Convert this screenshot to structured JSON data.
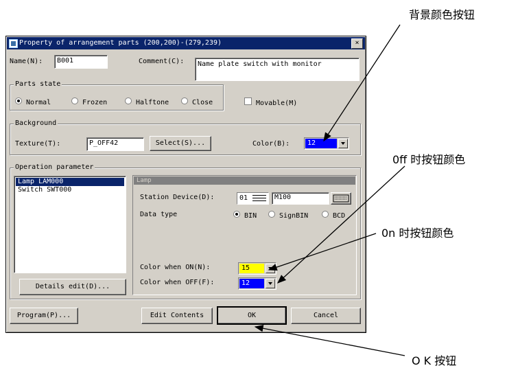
{
  "window": {
    "title": "Property of arrangement parts  (200,200)-(279,239)",
    "close_label": "×"
  },
  "name_field": {
    "label": "Name(N):",
    "value": "B001"
  },
  "comment_field": {
    "label": "Comment(C):",
    "value": "Name plate switch with monitor"
  },
  "parts_state": {
    "group_label": "Parts state",
    "options": [
      "Normal",
      "Frozen",
      "Halftone",
      "Close"
    ],
    "selected": "Normal",
    "movable_label": "Movable(M)"
  },
  "background": {
    "group_label": "Background",
    "texture_label": "Texture(T):",
    "texture_value": "P_OFF42",
    "select_button": "Select(S)...",
    "color_label": "Color(B):",
    "color_value": "12",
    "color_hex": "#0000ff"
  },
  "operation": {
    "group_label": "Operation parameter",
    "list_items": [
      "Lamp LAM000",
      "Switch SWT000"
    ],
    "details_button": "Details edit(D)...",
    "panel_title": "Lamp",
    "station_label": "Station Device(D):",
    "station_value": "01",
    "device_value": "M100",
    "data_type_label": "Data type",
    "data_types": [
      "BIN",
      "SignBIN",
      "BCD"
    ],
    "data_type_selected": "BIN",
    "color_on_label": "Color when ON(N):",
    "color_on_value": "15",
    "color_on_hex": "#ffff00",
    "color_off_label": "Color when OFF(F):",
    "color_off_value": "12",
    "color_off_hex": "#0000ff"
  },
  "buttons": {
    "program": "Program(P)...",
    "edit_contents": "Edit Contents",
    "ok": "OK",
    "cancel": "Cancel"
  },
  "annotations": {
    "bg_color": "背景颜色按钮",
    "off_color": "0ff 时按钮颜色",
    "on_color": "0n 时按钮颜色",
    "ok": "O K 按钮"
  }
}
